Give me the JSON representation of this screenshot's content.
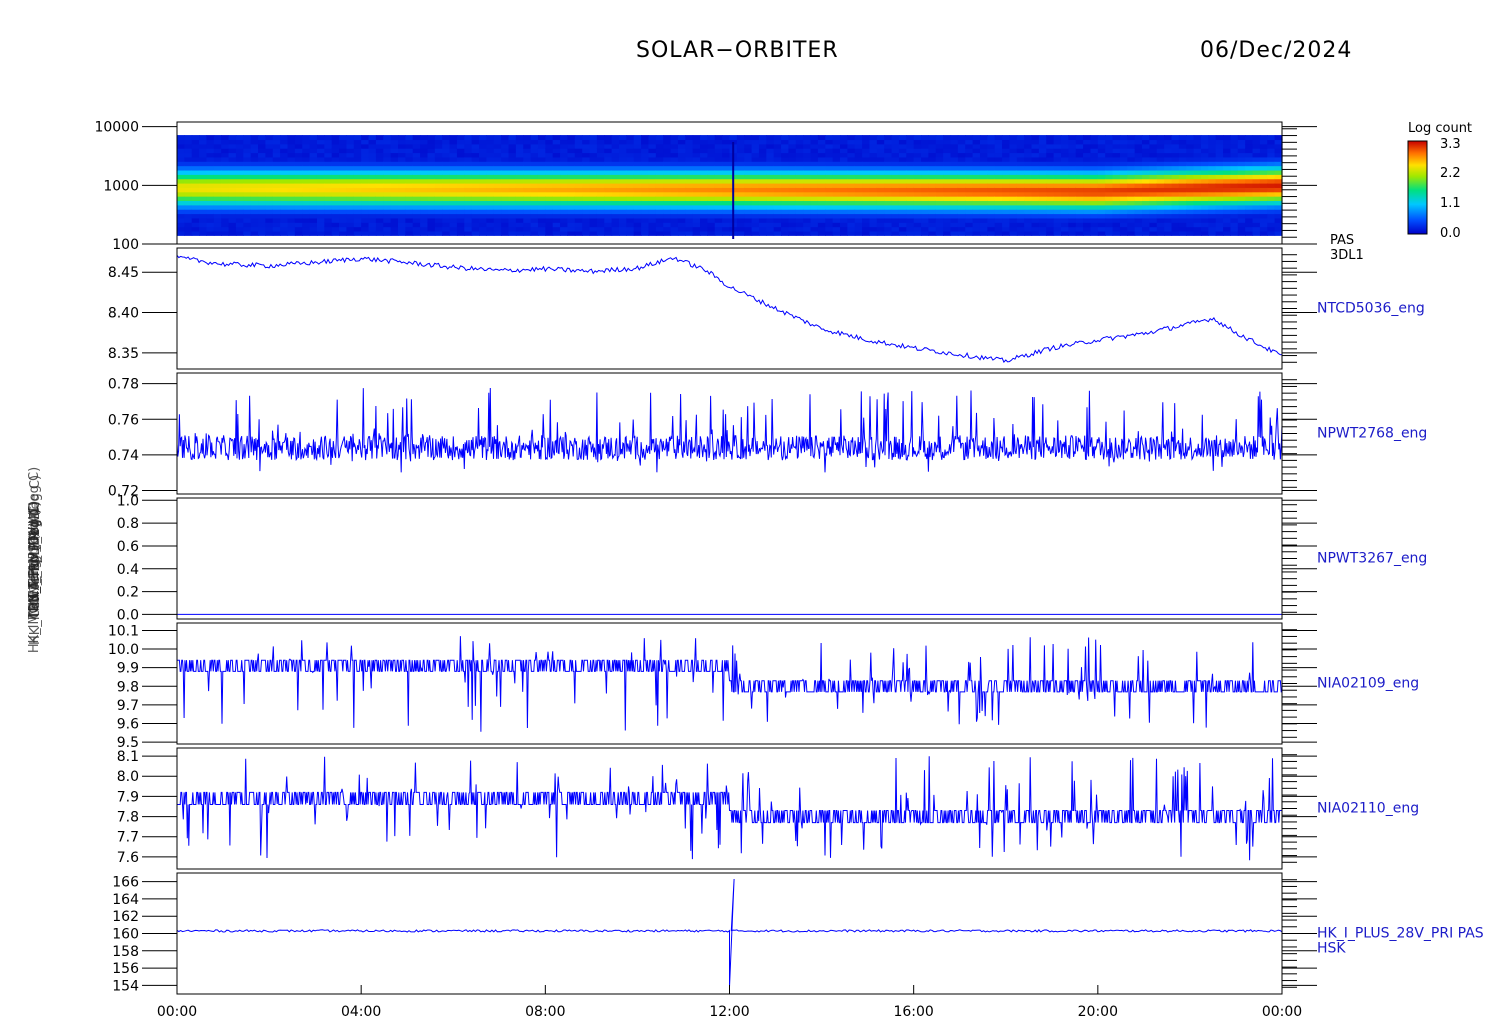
{
  "header": {
    "title": "SOLAR−ORBITER",
    "date": "06/Dec/2024"
  },
  "colors": {
    "trace": "#0000ff",
    "label": "#1c1cc8",
    "axis": "#000000"
  },
  "chart_data": {
    "type": "line",
    "x_ticks": [
      "00:00",
      "04:00",
      "08:00",
      "12:00",
      "16:00",
      "20:00",
      "00:00"
    ],
    "x_range_hours": [
      0,
      24
    ],
    "left_axis_labels_overlapping": [
      "Energy (eV)",
      "Ccd Temp (Deg C)",
      "TDS Temp (Deg C)",
      "RWAI_R_LFR (V)",
      "HK_IMON_TEMP_IMU (Deg C)",
      "HK_IMON_TEMP_2 (Deg C)",
      "HK_I_PLUS (mA)"
    ],
    "panels": [
      {
        "id": "pas-3dl1",
        "type": "heatmap",
        "right_label": [
          "PAS",
          "3DL1"
        ],
        "yscale": "log",
        "ylim": [
          100,
          12000
        ],
        "ytick_labels": [
          "100",
          "1000",
          "10000"
        ],
        "ytick_values": [
          100,
          1000,
          10000
        ],
        "colorbar": {
          "title": "Log count",
          "ticks": [
            "0.0",
            "1.1",
            "2.2",
            "3.3"
          ],
          "range": [
            0.0,
            3.3
          ]
        },
        "peak_energy_ev": {
          "hours": [
            0,
            6,
            12,
            18,
            20,
            24
          ],
          "values": [
            900,
            880,
            860,
            820,
            800,
            1000
          ]
        },
        "notes": "spike at 12:05"
      },
      {
        "id": "ntcd5036",
        "right_label": "NTCD5036_eng",
        "ylim": [
          8.33,
          8.48
        ],
        "ytick_labels": [
          "8.35",
          "8.40",
          "8.45"
        ],
        "ytick_values": [
          8.35,
          8.4,
          8.45
        ],
        "series": [
          {
            "x": [
              0,
              1,
              2,
              3,
              4,
              5,
              6,
              7,
              8,
              9,
              10,
              10.8,
              11.5,
              12,
              13,
              14,
              15,
              16,
              17,
              18,
              19,
              20,
              21,
              22,
              22.5,
              23,
              24
            ],
            "y": [
              8.468,
              8.46,
              8.458,
              8.462,
              8.467,
              8.462,
              8.456,
              8.452,
              8.454,
              8.451,
              8.455,
              8.468,
              8.452,
              8.432,
              8.405,
              8.38,
              8.366,
              8.356,
              8.348,
              8.34,
              8.356,
              8.366,
              8.374,
              8.386,
              8.393,
              8.375,
              8.346
            ]
          }
        ]
      },
      {
        "id": "npwt2768",
        "right_label": "NPWT2768_eng",
        "ylim": [
          0.718,
          0.786
        ],
        "ytick_labels": [
          "0.72",
          "0.74",
          "0.76",
          "0.78"
        ],
        "ytick_values": [
          0.72,
          0.74,
          0.76,
          0.78
        ],
        "series": [
          {
            "baseline": 0.744,
            "noise_range": [
              0.726,
              0.782
            ]
          }
        ]
      },
      {
        "id": "npwt3267",
        "right_label": "NPWT3267_eng",
        "ylim": [
          -0.04,
          1.02
        ],
        "ytick_labels": [
          "0.0",
          "0.2",
          "0.4",
          "0.6",
          "0.8",
          "1.0"
        ],
        "ytick_values": [
          0.0,
          0.2,
          0.4,
          0.6,
          0.8,
          1.0
        ],
        "series": [
          {
            "constant": 0.0
          }
        ]
      },
      {
        "id": "nia02109",
        "right_label": "NIA02109_eng",
        "ylim": [
          9.49,
          10.14
        ],
        "ytick_labels": [
          "9.5",
          "9.6",
          "9.7",
          "9.8",
          "9.9",
          "10.0",
          "10.1"
        ],
        "ytick_values": [
          9.5,
          9.6,
          9.7,
          9.8,
          9.9,
          10.0,
          10.1
        ],
        "series": [
          {
            "levels_before_12h": [
              9.88,
              9.94
            ],
            "levels_after_12h": [
              9.77,
              9.83
            ],
            "noise_range": [
              9.55,
              10.07
            ]
          }
        ]
      },
      {
        "id": "nia02110",
        "right_label": "NIA02110_eng",
        "ylim": [
          7.54,
          8.14
        ],
        "ytick_labels": [
          "7.6",
          "7.7",
          "7.8",
          "7.9",
          "8.0",
          "8.1"
        ],
        "ytick_values": [
          7.6,
          7.7,
          7.8,
          7.9,
          8.0,
          8.1
        ],
        "series": [
          {
            "levels_before_12h": [
              7.86,
              7.92
            ],
            "levels_after_12h": [
              7.77,
              7.83
            ],
            "noise_range": [
              7.58,
              8.1
            ]
          }
        ]
      },
      {
        "id": "hk-i-plus",
        "right_label": [
          "HK_I_PLUS_28V_PRI PAS",
          "HSK"
        ],
        "ylim": [
          153,
          167
        ],
        "ytick_labels": [
          "154",
          "156",
          "158",
          "160",
          "162",
          "164",
          "166"
        ],
        "ytick_values": [
          154,
          156,
          158,
          160,
          162,
          164,
          166
        ],
        "series": [
          {
            "baseline": 160.3,
            "spike_hour": 12.0,
            "spike_min": 153.8,
            "spike_max": 166.3
          }
        ]
      }
    ]
  }
}
